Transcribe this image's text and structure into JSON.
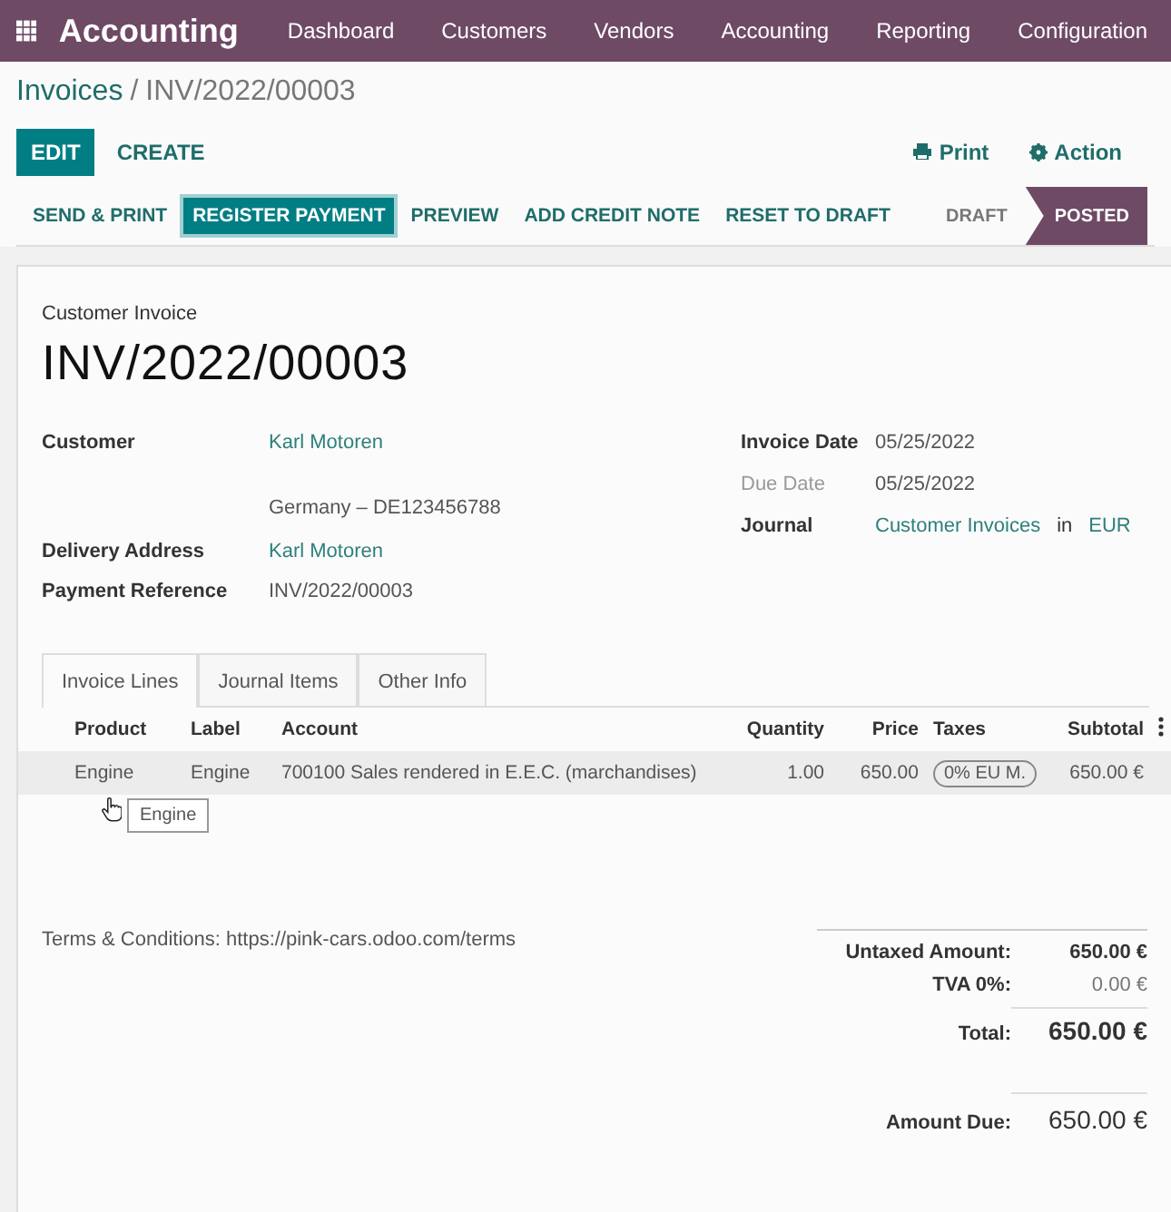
{
  "navbar": {
    "app_title": "Accounting",
    "menu": [
      "Dashboard",
      "Customers",
      "Vendors",
      "Accounting",
      "Reporting",
      "Configuration"
    ]
  },
  "breadcrumb": {
    "parent": "Invoices",
    "separator": "/",
    "current": "INV/2022/00003"
  },
  "control_panel": {
    "buttons": [
      {
        "label": "EDIT",
        "primary": true
      },
      {
        "label": "CREATE",
        "primary": false
      }
    ],
    "print": "Print",
    "action": "Action"
  },
  "status_bar": {
    "buttons": [
      {
        "label": "SEND & PRINT",
        "primary": false
      },
      {
        "label": "REGISTER PAYMENT",
        "primary": true
      },
      {
        "label": "PREVIEW",
        "primary": false
      },
      {
        "label": "ADD CREDIT NOTE",
        "primary": false
      },
      {
        "label": "RESET TO DRAFT",
        "primary": false
      }
    ],
    "stages": [
      {
        "label": "DRAFT",
        "selected": false
      },
      {
        "label": "POSTED",
        "selected": true
      }
    ]
  },
  "sheet": {
    "subtitle": "Customer Invoice",
    "number": "INV/2022/00003",
    "left_fields": [
      {
        "label": "Customer",
        "value": "Karl Motoren",
        "kind": "link",
        "note": "Germany – DE123456788"
      },
      {
        "label": "Delivery Address",
        "value": "Karl Motoren",
        "kind": "link"
      },
      {
        "label": "Payment Reference",
        "value": "INV/2022/00003",
        "kind": "text"
      }
    ],
    "right_fields": [
      {
        "label": "Invoice Date",
        "value": "05/25/2022",
        "kind": "text",
        "muted": false
      },
      {
        "label": "Due Date",
        "value": "05/25/2022",
        "kind": "text",
        "muted": true
      },
      {
        "label": "Journal",
        "value": "Customer Invoices",
        "kind": "link",
        "muted": false,
        "joiner": "in",
        "currency": "EUR"
      }
    ],
    "tabs": [
      {
        "label": "Invoice Lines",
        "selected": true
      },
      {
        "label": "Journal Items",
        "selected": false
      },
      {
        "label": "Other Info",
        "selected": false
      }
    ],
    "table": {
      "columns": [
        "Product",
        "Label",
        "Account",
        "Quantity",
        "Price",
        "Taxes",
        "Subtotal"
      ],
      "rows": [
        {
          "product": "Engine",
          "label": "Engine",
          "account": "700100 Sales rendered in E.E.C. (marchandises)",
          "quantity": "1.00",
          "price": "650.00",
          "taxes": "0% EU M.",
          "subtotal": "650.00 €"
        }
      ]
    },
    "tooltip": "Engine",
    "terms": "Terms & Conditions: https://pink-cars.odoo.com/terms",
    "totals": [
      {
        "label": "Untaxed Amount:",
        "value": "650.00 €",
        "kind": "strong"
      },
      {
        "label": "TVA 0%:",
        "value": "0.00 €",
        "kind": "muted"
      },
      {
        "label": "Total:",
        "value": "650.00 €",
        "kind": "total"
      }
    ],
    "amount_due": {
      "label": "Amount Due:",
      "value": "650.00 €"
    }
  }
}
